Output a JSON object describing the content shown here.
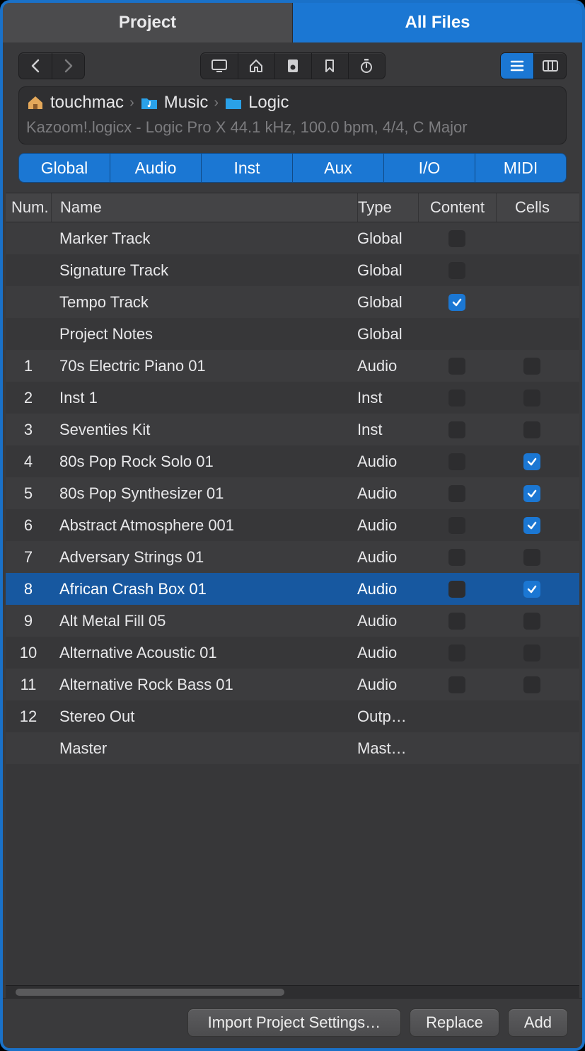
{
  "tabs": {
    "project": "Project",
    "allfiles": "All Files"
  },
  "breadcrumb": {
    "parts": [
      "touchmac",
      "Music",
      "Logic"
    ]
  },
  "project_info": "Kazoom!.logicx - Logic Pro X 44.1 kHz, 100.0 bpm, 4/4, C Major",
  "filters": [
    "Global",
    "Audio",
    "Inst",
    "Aux",
    "I/O",
    "MIDI"
  ],
  "columns": {
    "num": "Num.",
    "name": "Name",
    "type": "Type",
    "content": "Content",
    "cells": "Cells"
  },
  "rows": [
    {
      "num": "",
      "name": "Marker Track",
      "type": "Global",
      "content_cb": "off",
      "cells_cb": "none"
    },
    {
      "num": "",
      "name": "Signature Track",
      "type": "Global",
      "content_cb": "off",
      "cells_cb": "none"
    },
    {
      "num": "",
      "name": "Tempo Track",
      "type": "Global",
      "content_cb": "on",
      "cells_cb": "none"
    },
    {
      "num": "",
      "name": "Project Notes",
      "type": "Global",
      "content_cb": "none",
      "cells_cb": "none"
    },
    {
      "num": "1",
      "name": "70s Electric Piano 01",
      "type": "Audio",
      "content_cb": "off",
      "cells_cb": "off"
    },
    {
      "num": "2",
      "name": "Inst 1",
      "type": "Inst",
      "content_cb": "off",
      "cells_cb": "off"
    },
    {
      "num": "3",
      "name": "Seventies Kit",
      "type": "Inst",
      "content_cb": "off",
      "cells_cb": "off"
    },
    {
      "num": "4",
      "name": "80s Pop Rock Solo 01",
      "type": "Audio",
      "content_cb": "off",
      "cells_cb": "on"
    },
    {
      "num": "5",
      "name": "80s Pop Synthesizer 01",
      "type": "Audio",
      "content_cb": "off",
      "cells_cb": "on"
    },
    {
      "num": "6",
      "name": "Abstract Atmosphere 001",
      "type": "Audio",
      "content_cb": "off",
      "cells_cb": "on"
    },
    {
      "num": "7",
      "name": "Adversary Strings 01",
      "type": "Audio",
      "content_cb": "off",
      "cells_cb": "off"
    },
    {
      "num": "8",
      "name": "African Crash Box 01",
      "type": "Audio",
      "content_cb": "off",
      "cells_cb": "on",
      "selected": true
    },
    {
      "num": "9",
      "name": "Alt Metal Fill 05",
      "type": "Audio",
      "content_cb": "off",
      "cells_cb": "off"
    },
    {
      "num": "10",
      "name": "Alternative Acoustic 01",
      "type": "Audio",
      "content_cb": "off",
      "cells_cb": "off"
    },
    {
      "num": "11",
      "name": "Alternative Rock Bass 01",
      "type": "Audio",
      "content_cb": "off",
      "cells_cb": "off"
    },
    {
      "num": "12",
      "name": "Stereo Out",
      "type": "Outp…",
      "content_cb": "none",
      "cells_cb": "none"
    },
    {
      "num": "",
      "name": "Master",
      "type": "Mast…",
      "content_cb": "none",
      "cells_cb": "none"
    }
  ],
  "footer": {
    "import": "Import Project Settings…",
    "replace": "Replace",
    "add": "Add"
  }
}
